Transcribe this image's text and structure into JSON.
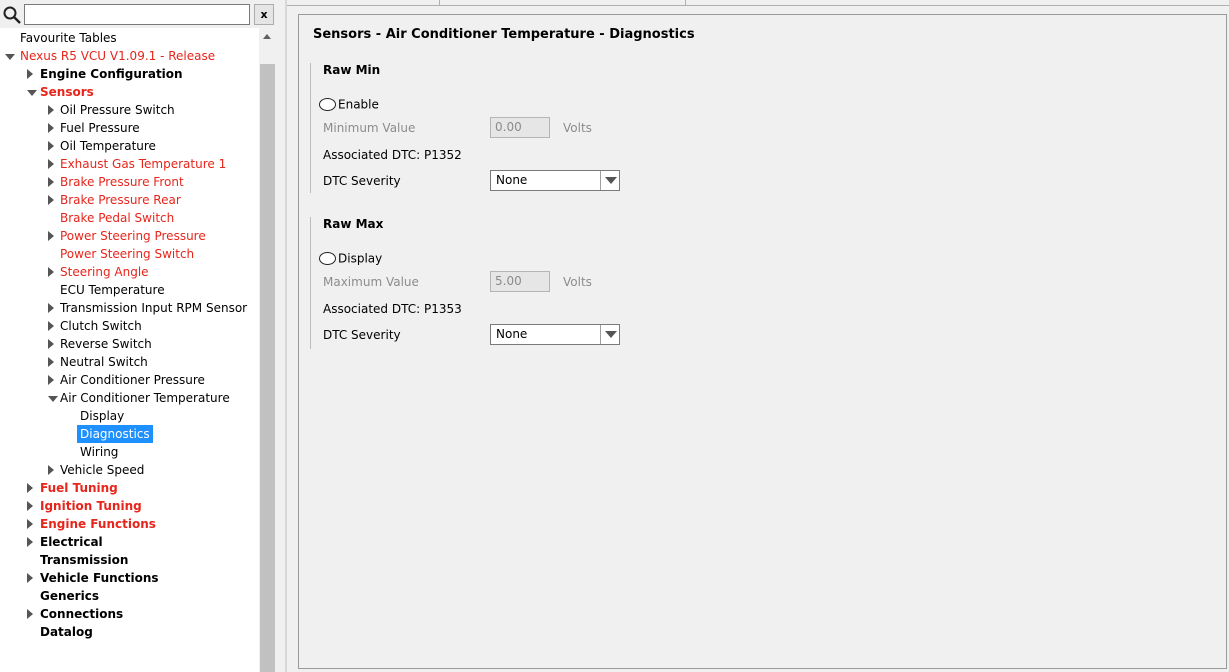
{
  "search": {
    "placeholder": "",
    "clear_label": "x"
  },
  "tree": [
    {
      "label": "Favourite Tables",
      "depth": 0,
      "arrow": "none",
      "bold": false,
      "red": false
    },
    {
      "label": "Nexus R5 VCU V1.09.1 - Release",
      "depth": 0,
      "arrow": "down",
      "bold": false,
      "red": true,
      "root": true
    },
    {
      "label": "Engine Configuration",
      "depth": 1,
      "arrow": "right",
      "bold": true,
      "red": false
    },
    {
      "label": "Sensors",
      "depth": 1,
      "arrow": "down",
      "bold": true,
      "red": true
    },
    {
      "label": "Oil Pressure Switch",
      "depth": 2,
      "arrow": "right",
      "bold": false,
      "red": false
    },
    {
      "label": "Fuel Pressure",
      "depth": 2,
      "arrow": "right",
      "bold": false,
      "red": false
    },
    {
      "label": "Oil Temperature",
      "depth": 2,
      "arrow": "right",
      "bold": false,
      "red": false
    },
    {
      "label": "Exhaust Gas Temperature 1",
      "depth": 2,
      "arrow": "right",
      "bold": false,
      "red": true
    },
    {
      "label": "Brake Pressure Front",
      "depth": 2,
      "arrow": "right",
      "bold": false,
      "red": true
    },
    {
      "label": "Brake Pressure Rear",
      "depth": 2,
      "arrow": "right",
      "bold": false,
      "red": true
    },
    {
      "label": "Brake Pedal Switch",
      "depth": 2,
      "arrow": "none",
      "bold": false,
      "red": true
    },
    {
      "label": "Power Steering Pressure",
      "depth": 2,
      "arrow": "right",
      "bold": false,
      "red": true
    },
    {
      "label": "Power Steering Switch",
      "depth": 2,
      "arrow": "none",
      "bold": false,
      "red": true
    },
    {
      "label": "Steering Angle",
      "depth": 2,
      "arrow": "right",
      "bold": false,
      "red": true
    },
    {
      "label": "ECU Temperature",
      "depth": 2,
      "arrow": "none",
      "bold": false,
      "red": false
    },
    {
      "label": "Transmission Input RPM Sensor",
      "depth": 2,
      "arrow": "right",
      "bold": false,
      "red": false
    },
    {
      "label": "Clutch Switch",
      "depth": 2,
      "arrow": "right",
      "bold": false,
      "red": false
    },
    {
      "label": "Reverse Switch",
      "depth": 2,
      "arrow": "right",
      "bold": false,
      "red": false
    },
    {
      "label": "Neutral Switch",
      "depth": 2,
      "arrow": "right",
      "bold": false,
      "red": false
    },
    {
      "label": "Air Conditioner Pressure",
      "depth": 2,
      "arrow": "right",
      "bold": false,
      "red": false
    },
    {
      "label": "Air Conditioner Temperature",
      "depth": 2,
      "arrow": "down",
      "bold": false,
      "red": false
    },
    {
      "label": "Display",
      "depth": 3,
      "arrow": "none",
      "bold": false,
      "red": false
    },
    {
      "label": "Diagnostics",
      "depth": 3,
      "arrow": "none",
      "bold": false,
      "red": false,
      "selected": true
    },
    {
      "label": "Wiring",
      "depth": 3,
      "arrow": "none",
      "bold": false,
      "red": false
    },
    {
      "label": "Vehicle Speed",
      "depth": 2,
      "arrow": "right",
      "bold": false,
      "red": false
    },
    {
      "label": "Fuel Tuning",
      "depth": 1,
      "arrow": "right",
      "bold": true,
      "red": true
    },
    {
      "label": "Ignition Tuning",
      "depth": 1,
      "arrow": "right",
      "bold": true,
      "red": true
    },
    {
      "label": "Engine Functions",
      "depth": 1,
      "arrow": "right",
      "bold": true,
      "red": true
    },
    {
      "label": "Electrical",
      "depth": 1,
      "arrow": "right",
      "bold": true,
      "red": false
    },
    {
      "label": "Transmission",
      "depth": 1,
      "arrow": "none",
      "bold": true,
      "red": false
    },
    {
      "label": "Vehicle Functions",
      "depth": 1,
      "arrow": "right",
      "bold": true,
      "red": false
    },
    {
      "label": "Generics",
      "depth": 1,
      "arrow": "none",
      "bold": true,
      "red": false
    },
    {
      "label": "Connections",
      "depth": 1,
      "arrow": "right",
      "bold": true,
      "red": false
    },
    {
      "label": "Datalog",
      "depth": 1,
      "arrow": "none",
      "bold": true,
      "red": false
    }
  ],
  "panel": {
    "title": "Sensors - Air Conditioner Temperature - Diagnostics",
    "raw_min": {
      "title": "Raw Min",
      "radio_label": "Enable",
      "value_label": "Minimum Value",
      "value": "0.00",
      "unit": "Volts",
      "dtc": "Associated DTC: P1352",
      "severity_label": "DTC Severity",
      "severity_value": "None"
    },
    "raw_max": {
      "title": "Raw Max",
      "radio_label": "Display",
      "value_label": "Maximum Value",
      "value": "5.00",
      "unit": "Volts",
      "dtc": "Associated DTC: P1353",
      "severity_label": "DTC Severity",
      "severity_value": "None"
    }
  },
  "colors": {
    "red_item": "#e8251b",
    "selection": "#1e90ff"
  }
}
